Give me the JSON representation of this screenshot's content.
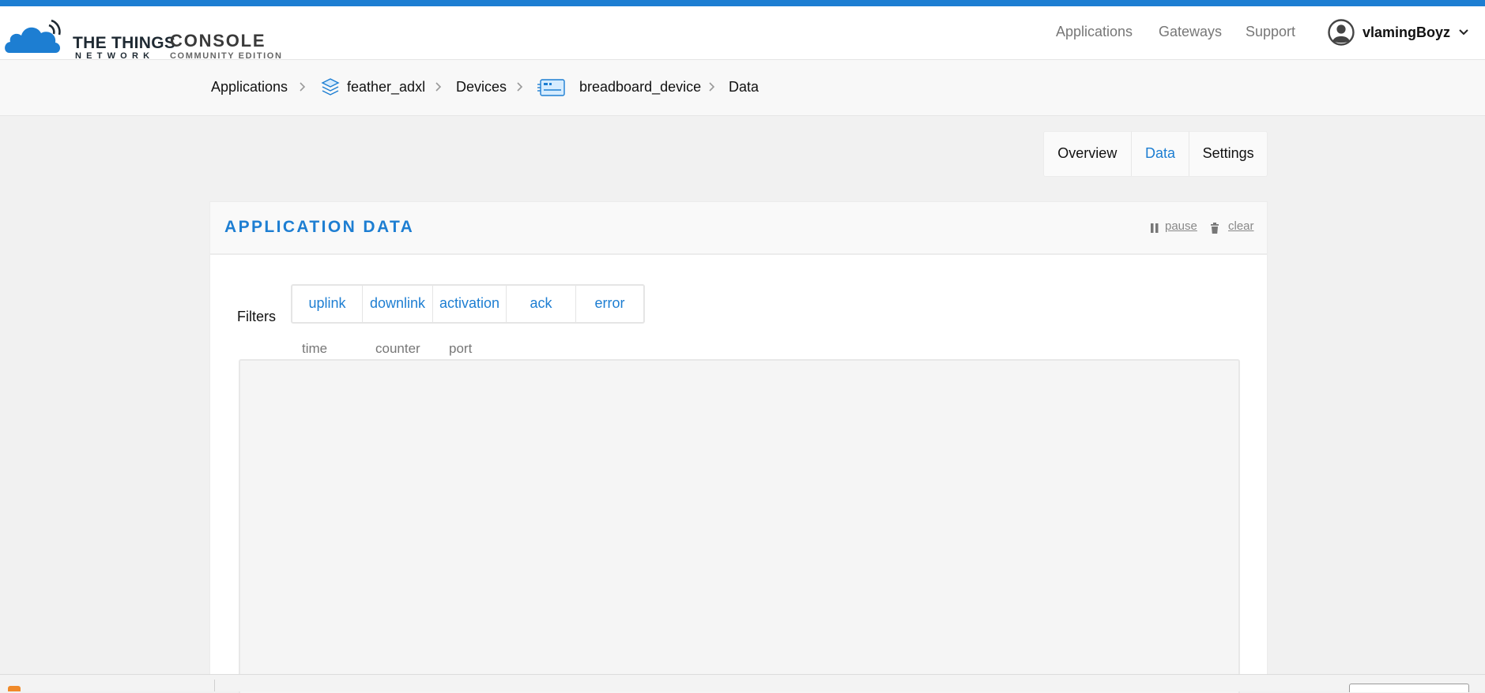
{
  "app": {
    "brand_main": "THE THINGS",
    "brand_sub": "NETWORK",
    "console_title": "CONSOLE",
    "console_subtitle": "COMMUNITY EDITION",
    "accent_color": "#1d7ed2"
  },
  "header": {
    "nav": [
      "Applications",
      "Gateways",
      "Support"
    ],
    "username": "vlamingBoyz",
    "user_icon": "user-avatar-icon",
    "dropdown_icon": "chevron-down-icon"
  },
  "breadcrumb": {
    "items": [
      "Applications",
      "feather_adxl",
      "Devices",
      "breadboard_device",
      "Data"
    ],
    "separator_icon": "chevron-right-icon",
    "application_icon": "layers-icon",
    "device_icon": "device-board-icon"
  },
  "tabs": {
    "items": [
      "Overview",
      "Data",
      "Settings"
    ],
    "active": "Data"
  },
  "panel": {
    "title": "APPLICATION DATA",
    "pause_label": "pause",
    "clear_label": "clear",
    "pause_icon": "pause-icon",
    "clear_icon": "trash-icon"
  },
  "filters": {
    "label": "Filters",
    "options": [
      "uplink",
      "downlink",
      "activation",
      "ack",
      "error"
    ]
  },
  "table": {
    "columns": [
      "time",
      "counter",
      "port"
    ]
  }
}
